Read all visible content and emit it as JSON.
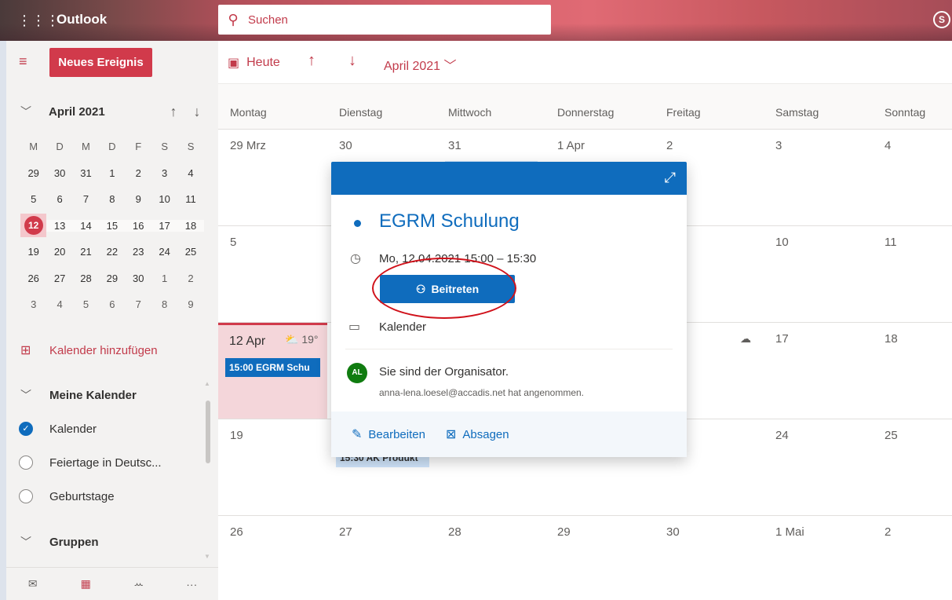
{
  "header": {
    "app_name": "Outlook",
    "search_placeholder": "Suchen",
    "icons": [
      "waffle-icon",
      "search-icon",
      "skype-icon"
    ]
  },
  "sidebar": {
    "new_event_label": "Neues Ereignis",
    "mini_calendar": {
      "month_label": "April 2021",
      "weekday_headers": [
        "M",
        "D",
        "M",
        "D",
        "F",
        "S",
        "S"
      ],
      "weeks": [
        [
          "29",
          "30",
          "31",
          "1",
          "2",
          "3",
          "4"
        ],
        [
          "5",
          "6",
          "7",
          "8",
          "9",
          "10",
          "11"
        ],
        [
          "12",
          "13",
          "14",
          "15",
          "16",
          "17",
          "18"
        ],
        [
          "19",
          "20",
          "21",
          "22",
          "23",
          "24",
          "25"
        ],
        [
          "26",
          "27",
          "28",
          "29",
          "30",
          "1",
          "2"
        ],
        [
          "3",
          "4",
          "5",
          "6",
          "7",
          "8",
          "9"
        ]
      ],
      "today": "12"
    },
    "add_calendar_label": "Kalender hinzufügen",
    "my_calendars_label": "Meine Kalender",
    "calendars": [
      {
        "label": "Kalender",
        "checked": true
      },
      {
        "label": "Feiertage in Deutsc...",
        "checked": false
      },
      {
        "label": "Geburtstage",
        "checked": false
      }
    ],
    "groups_label": "Gruppen",
    "bottom_nav_icons": [
      "mail-icon",
      "calendar-icon",
      "people-icon",
      "more-icon"
    ]
  },
  "toolbar": {
    "today_label": "Heute",
    "month_label": "April 2021"
  },
  "calendar": {
    "weekdays": [
      "Montag",
      "Dienstag",
      "Mittwoch",
      "Donnerstag",
      "Freitag",
      "Samstag",
      "Sonntag"
    ],
    "weeks": [
      [
        "29 Mrz",
        "30",
        "31",
        "1 Apr",
        "2",
        "3",
        "4"
      ],
      [
        "5",
        "",
        "",
        "",
        "",
        "10",
        "11"
      ],
      [
        "12 Apr",
        "",
        "",
        "",
        "",
        "17",
        "18"
      ],
      [
        "19",
        "",
        "",
        "",
        "",
        "24",
        "25"
      ],
      [
        "26",
        "27",
        "28",
        "29",
        "30",
        "1 Mai",
        "2"
      ]
    ],
    "current_day_weather": "19°",
    "events": {
      "monday_12": "15:00 EGRM Schu",
      "tuesday_20": "15:30 AK Produkt"
    }
  },
  "popup": {
    "title": "EGRM Schulung",
    "time": "Mo, 12.04.2021 15:00 – 15:30",
    "join_label": "Beitreten",
    "calendar_name": "Kalender",
    "avatar_initials": "AL",
    "organizer_text": "Sie sind der Organisator.",
    "attendee_status": "anna-lena.loesel@accadis.net hat angenommen.",
    "edit_label": "Bearbeiten",
    "cancel_label": "Absagen"
  },
  "colors": {
    "accent": "#d13a4b",
    "event_blue": "#0f6cbd",
    "highlight_ellipse": "#d0111a"
  }
}
